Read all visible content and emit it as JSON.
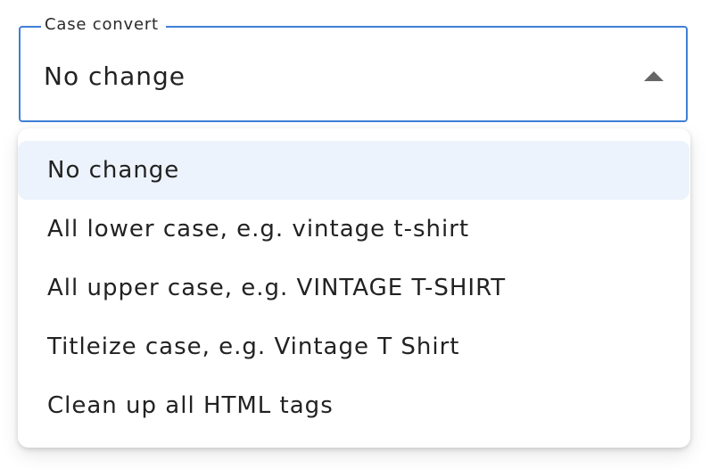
{
  "field": {
    "label": "Case convert",
    "selected_value": "No change",
    "focus_color": "#3f7fd6",
    "icon": "caret-up-icon"
  },
  "dropdown": {
    "options": [
      {
        "label": "No change",
        "selected": true
      },
      {
        "label": "All lower case, e.g. vintage t-shirt",
        "selected": false
      },
      {
        "label": "All upper case, e.g. VINTAGE T-SHIRT",
        "selected": false
      },
      {
        "label": "Titleize case, e.g. Vintage T Shirt",
        "selected": false
      },
      {
        "label": "Clean up all HTML tags",
        "selected": false
      }
    ],
    "selected_background": "#edf3fc"
  }
}
